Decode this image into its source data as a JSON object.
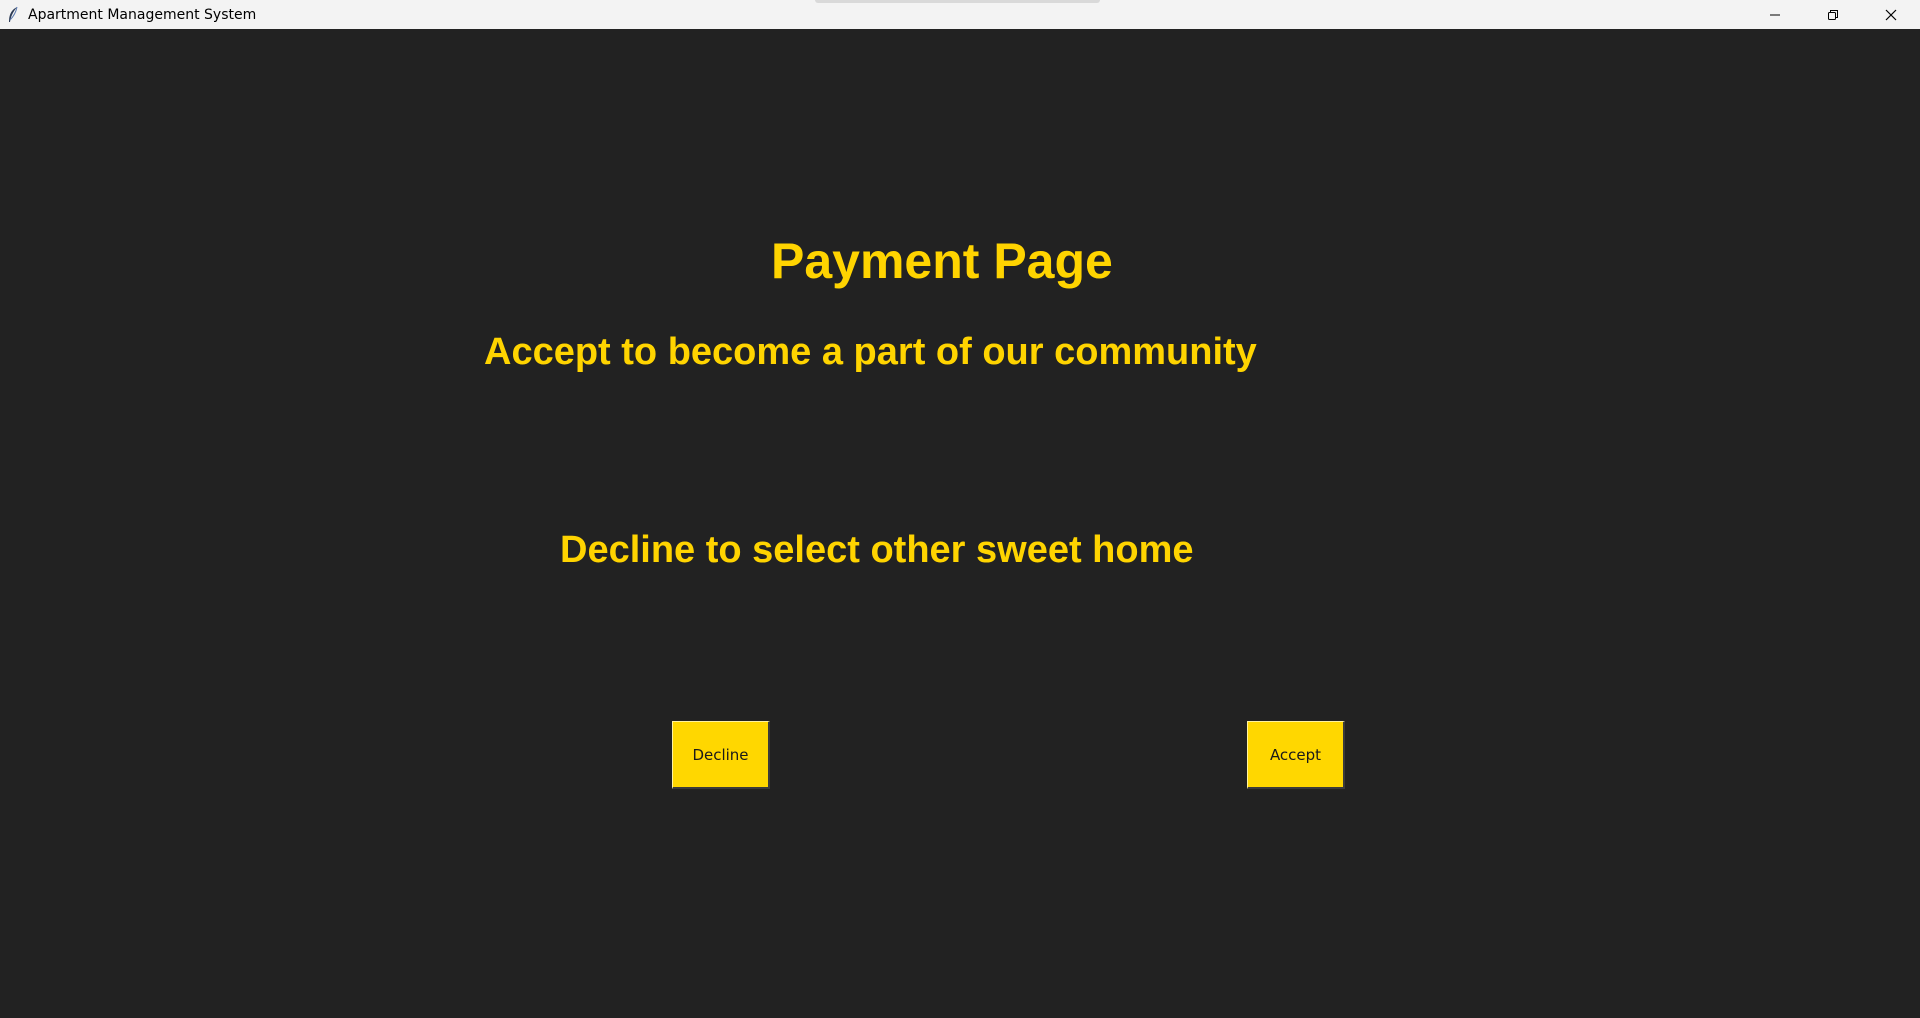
{
  "window": {
    "title": "Apartment Management System",
    "icon": "feather-icon",
    "controls": [
      "minimize-icon",
      "restore-icon",
      "close-icon"
    ]
  },
  "page": {
    "title": "Payment Page",
    "accept_message": "Accept to become a part of our community",
    "decline_message": "Decline to select other sweet home"
  },
  "buttons": {
    "decline_label": "Decline",
    "accept_label": "Accept"
  },
  "colors": {
    "background": "#222222",
    "accent": "#ffd700",
    "titlebar": "#f3f3f3"
  }
}
